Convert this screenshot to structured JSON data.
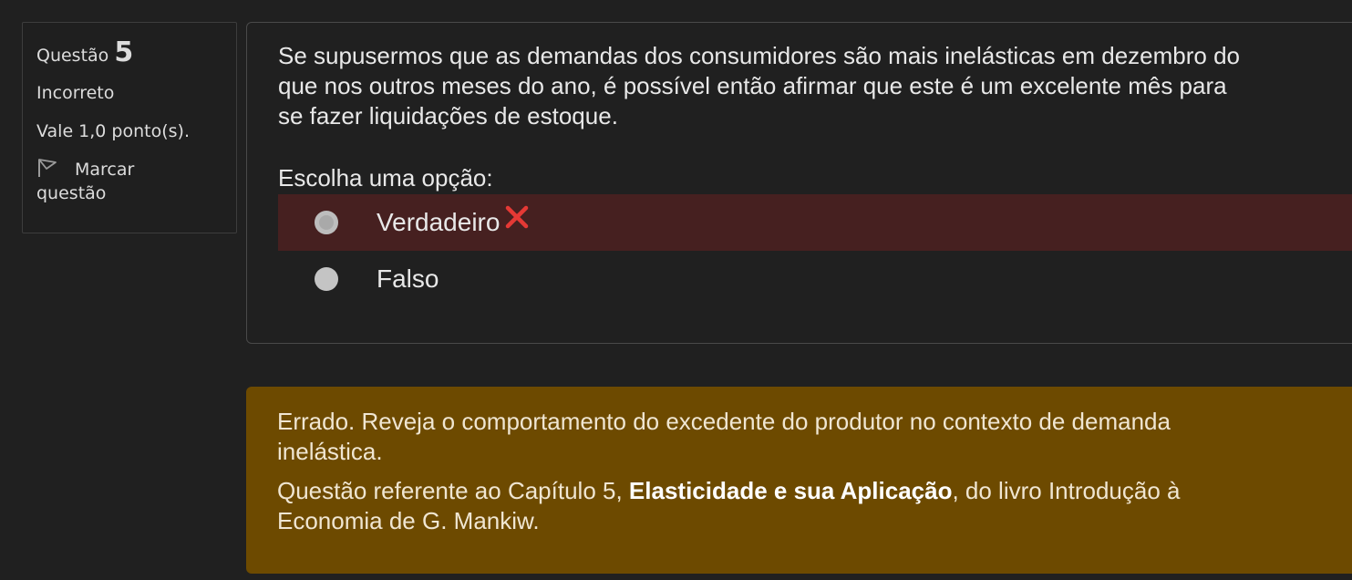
{
  "info": {
    "question_label": "Questão",
    "question_number": "5",
    "state": "Incorreto",
    "grade": "Vale 1,0 ponto(s).",
    "flag_line1": "Marcar",
    "flag_line2": "questão",
    "flag_icon": "flag-icon"
  },
  "question": {
    "line1": "Se supusermos que as demandas dos consumidores são mais inelásticas em dezembro do",
    "line2": "que nos outros meses do ano, é possível então afirmar que este é um excelente mês para",
    "line3": "se fazer liquidações de estoque.",
    "prompt": "Escolha uma opção:"
  },
  "options": [
    {
      "label": "Verdadeiro",
      "selected": true,
      "status": "incorrect",
      "status_icon": "cross-icon"
    },
    {
      "label": "Falso",
      "selected": false
    }
  ],
  "feedback": {
    "line1": "Errado. Reveja o comportamento do excedente do produtor no contexto de demanda",
    "line2": "inelástica.",
    "ref_prefix": "Questão referente ao Capítulo 5, ",
    "ref_bold": "Elasticidade e sua Aplicação",
    "ref_suffix": ", do livro Introdução à",
    "ref_line2": "Economia de G. Mankiw."
  },
  "colors": {
    "background": "#202020",
    "incorrect_row": "#462020",
    "feedback_bg": "#6d4a00",
    "cross": "#e53935"
  }
}
